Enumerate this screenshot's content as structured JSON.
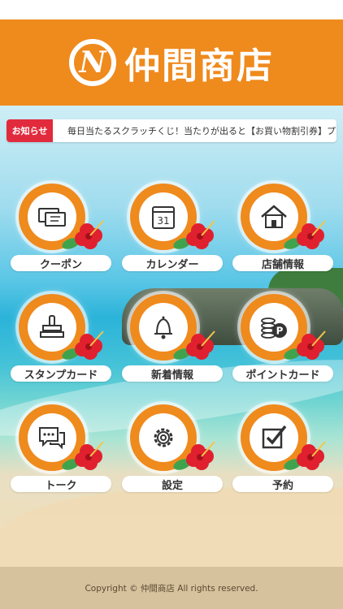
{
  "header": {
    "logo_letter": "N",
    "title": "仲間商店"
  },
  "notice": {
    "badge": "お知らせ",
    "text": "毎日当たるスクラッチくじ！当たりが出ると【お買い物割引券】プレゼント"
  },
  "menu": [
    {
      "label": "クーポン",
      "icon": "coupon-icon"
    },
    {
      "label": "カレンダー",
      "icon": "calendar-icon",
      "icon_text": "31"
    },
    {
      "label": "店舗情報",
      "icon": "store-icon"
    },
    {
      "label": "スタンプカード",
      "icon": "stamp-icon"
    },
    {
      "label": "新着情報",
      "icon": "bell-icon"
    },
    {
      "label": "ポイントカード",
      "icon": "coins-icon",
      "icon_text": "P"
    },
    {
      "label": "トーク",
      "icon": "chat-icon"
    },
    {
      "label": "設定",
      "icon": "gear-icon"
    },
    {
      "label": "予約",
      "icon": "checkbox-icon"
    }
  ],
  "footer": {
    "copyright": "Copyright © 仲間商店 All rights reserved."
  },
  "colors": {
    "accent": "#ef8a1d",
    "notice_badge": "#e12b3d",
    "flower": "#e0202e"
  }
}
